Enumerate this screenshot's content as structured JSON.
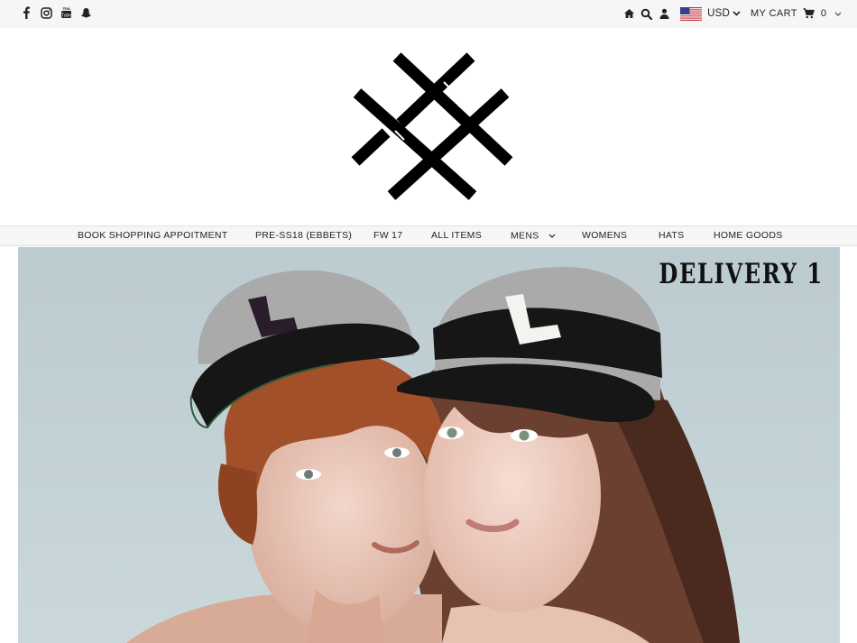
{
  "topbar": {
    "social_icons": [
      "facebook-icon",
      "instagram-icon",
      "youtube-icon",
      "snapchat-icon"
    ],
    "utility_icons": [
      "home-icon",
      "search-icon",
      "account-icon"
    ],
    "currency": {
      "flag": "us-flag-icon",
      "label": "USD"
    },
    "cart": {
      "label": "MY CART",
      "count": "0"
    }
  },
  "logo": {
    "name": "crossed-bars-logo"
  },
  "nav": {
    "items": [
      {
        "label": "BOOK SHOPPING APPOITMENT"
      },
      {
        "label": "PRE-SS18 (EBBETS)"
      },
      {
        "label": "FW 17"
      },
      {
        "label": "ALL ITEMS"
      },
      {
        "label": "MENS",
        "has_dropdown": true
      },
      {
        "label": "WOMENS"
      },
      {
        "label": "HATS"
      },
      {
        "label": "HOME GOODS"
      }
    ]
  },
  "hero": {
    "caption": "DELIVERY 1",
    "colors": {
      "background": "#c4d2d6",
      "cap_gray": "#a9aaa9",
      "cap_black": "#161616"
    }
  }
}
